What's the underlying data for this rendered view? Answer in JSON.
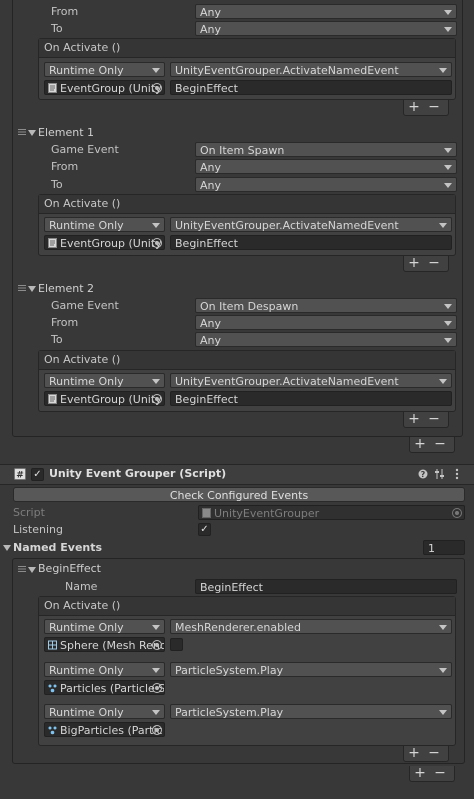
{
  "group_events": {
    "element0": {
      "from_label": "From",
      "from_value": "Any",
      "to_label": "To",
      "to_value": "Any",
      "event_header": "On Activate ()",
      "call": {
        "mode": "Runtime Only",
        "function": "UnityEventGrouper.ActivateNamedEvent",
        "target": "EventGroup (Unity",
        "argument": "BeginEffect"
      }
    },
    "element1": {
      "title": "Element 1",
      "game_event_label": "Game Event",
      "game_event_value": "On Item Spawn",
      "from_label": "From",
      "from_value": "Any",
      "to_label": "To",
      "to_value": "Any",
      "event_header": "On Activate ()",
      "call": {
        "mode": "Runtime Only",
        "function": "UnityEventGrouper.ActivateNamedEvent",
        "target": "EventGroup (Unity",
        "argument": "BeginEffect"
      }
    },
    "element2": {
      "title": "Element 2",
      "game_event_label": "Game Event",
      "game_event_value": "On Item Despawn",
      "from_label": "From",
      "from_value": "Any",
      "to_label": "To",
      "to_value": "Any",
      "event_header": "On Activate ()",
      "call": {
        "mode": "Runtime Only",
        "function": "UnityEventGrouper.ActivateNamedEvent",
        "target": "EventGroup (Unity",
        "argument": "BeginEffect"
      }
    },
    "plus": "+",
    "minus": "−"
  },
  "component": {
    "title": "Unity Event Grouper (Script)",
    "enabled": true,
    "check_button": "Check Configured Events",
    "script_label": "Script",
    "script_value": "UnityEventGrouper",
    "listening_label": "Listening",
    "listening_checked": "✓",
    "named_events_label": "Named Events",
    "named_events_count": "1",
    "begin_effect": {
      "title": "BeginEffect",
      "name_label": "Name",
      "name_value": "BeginEffect",
      "event_header": "On Activate ()",
      "calls": [
        {
          "mode": "Runtime Only",
          "function": "MeshRenderer.enabled",
          "target": "Sphere (Mesh Renc"
        },
        {
          "mode": "Runtime Only",
          "function": "ParticleSystem.Play",
          "target": "Particles (Particle S"
        },
        {
          "mode": "Runtime Only",
          "function": "ParticleSystem.Play",
          "target": "BigParticles (Partic"
        }
      ]
    }
  },
  "icons": {
    "script": "script-icon",
    "help": "help-icon",
    "preset": "preset-icon",
    "menu": "kebab-menu-icon",
    "object_picker": "object-picker-icon",
    "particle": "particle-system-icon",
    "mesh": "mesh-renderer-icon"
  }
}
